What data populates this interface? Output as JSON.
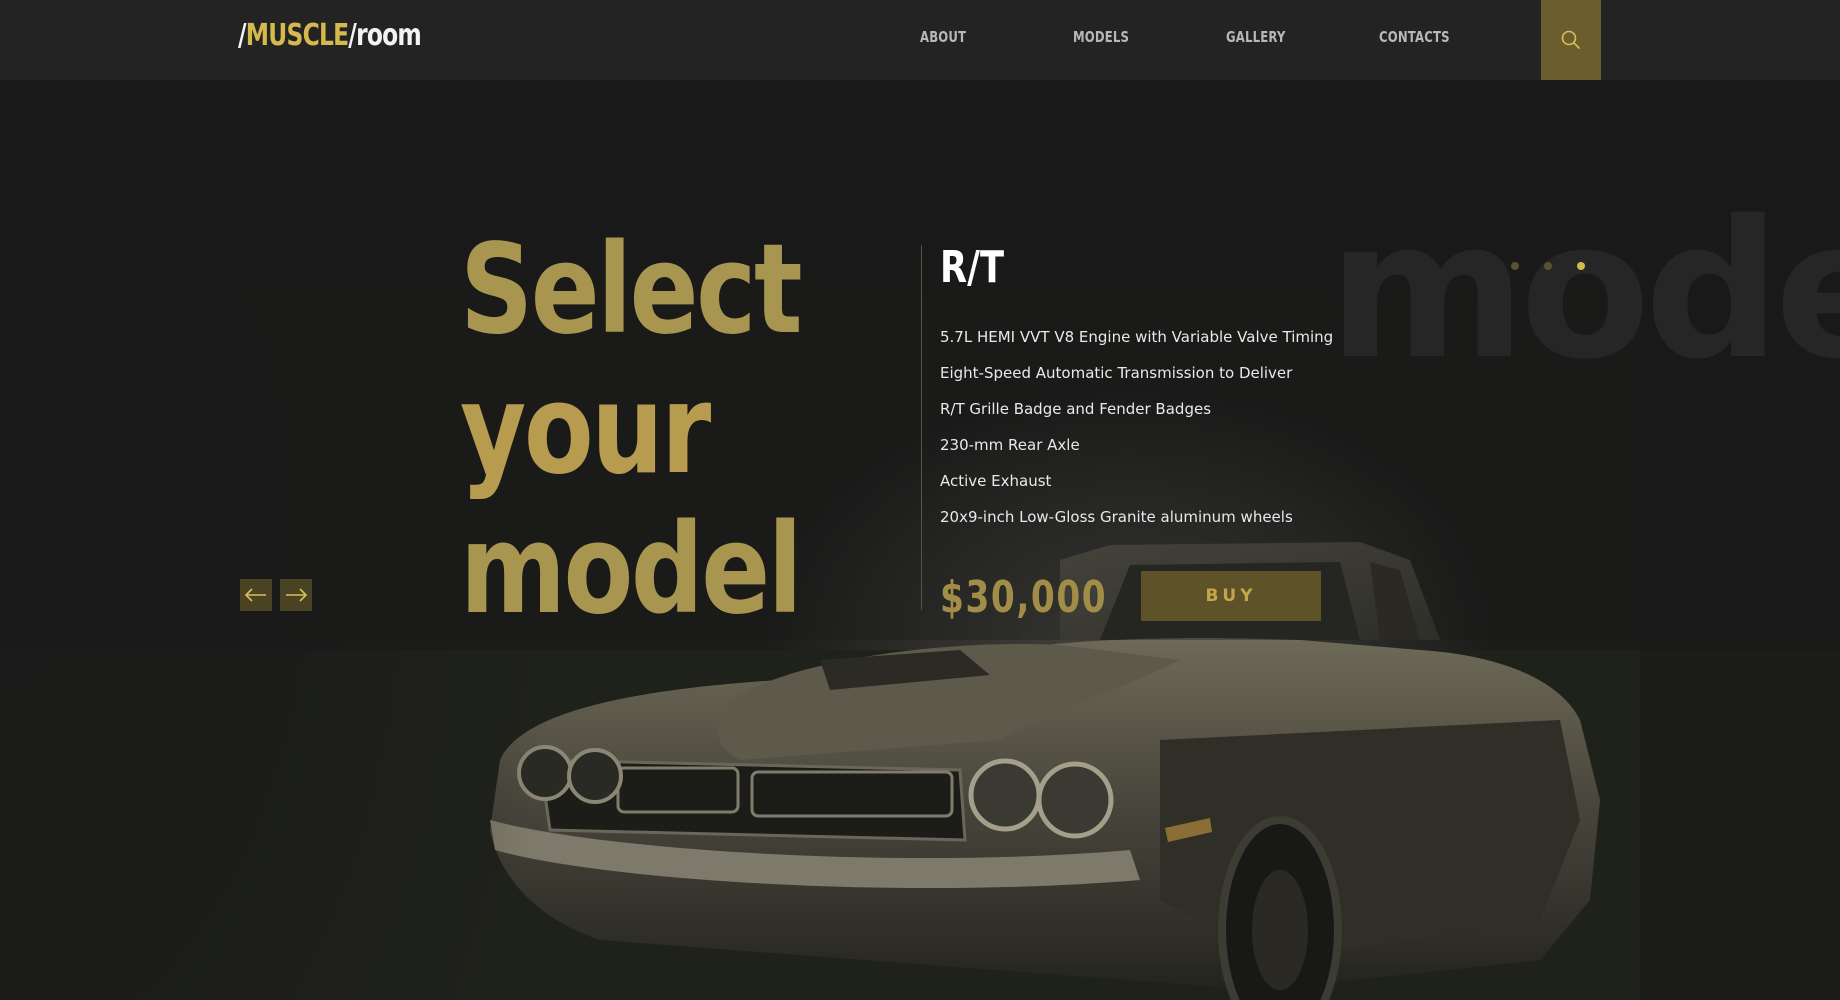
{
  "header": {
    "logo": {
      "slash1": "/",
      "brand": "MUSCLE",
      "slash2": "/",
      "suffix": "room"
    },
    "nav": [
      "ABOUT",
      "MODELS",
      "GALLERY",
      "CONTACTS"
    ],
    "search_icon": "search-icon"
  },
  "hero": {
    "background_word": "models",
    "headline": [
      "Select",
      "your",
      "model"
    ],
    "model_name": "R/T",
    "specs": [
      "5.7L HEMI VVT V8 Engine with Variable Valve Timing",
      "Eight-Speed Automatic Transmission to Deliver",
      "R/T Grille Badge and Fender Badges",
      "230-mm Rear Axle",
      "Active Exhaust",
      "20x9-inch Low-Gloss Granite aluminum wheels"
    ],
    "price": "$30,000",
    "buy_label": "BUY",
    "prev_icon": "arrow-left-icon",
    "next_icon": "arrow-right-icon",
    "slides": {
      "count": 3,
      "active": 3
    }
  },
  "colors": {
    "accent": "#d6b94c",
    "header_bg": "#232323",
    "page_bg": "#1a1a1a",
    "search_bg": "#6b5d2d",
    "button_bg": "#5e5328"
  }
}
